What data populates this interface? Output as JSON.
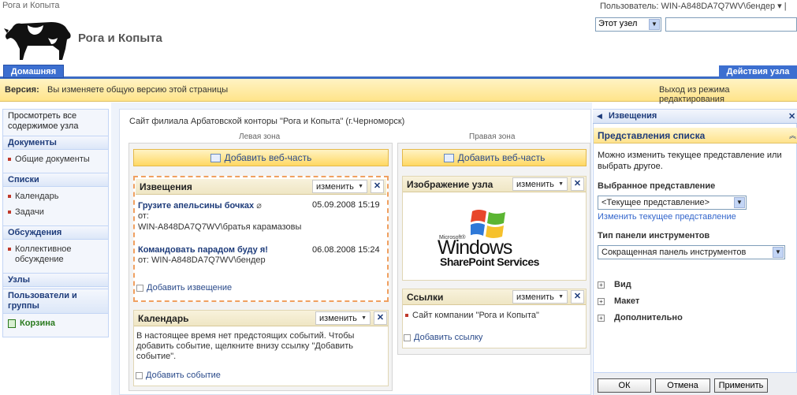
{
  "topbar": {
    "site_crumb": "Рога и Копыта",
    "user_label": "Пользователь: WIN-A848DA7Q7WV\\бендер ▾  |"
  },
  "header": {
    "site_title": "Рога и Копыта",
    "scope_value": "Этот узел",
    "search_value": ""
  },
  "nav": {
    "home_tab": "Домашняя",
    "site_actions": "Действия узла"
  },
  "edit_banner": {
    "version_label": "Версия:",
    "version_text": "Вы изменяете общую версию этой страницы",
    "exit_link": "Выход из режима редактирования"
  },
  "leftnav": {
    "view_all": "Просмотреть все содержимое узла",
    "documents": "Документы",
    "shared_docs": "Общие документы",
    "lists": "Списки",
    "calendar": "Календарь",
    "tasks": "Задачи",
    "discussions": "Обсуждения",
    "team_discussion": "Коллективное обсуждение",
    "sites": "Узлы",
    "people": "Пользователи и группы",
    "recycle_bin": "Корзина"
  },
  "page": {
    "description": "Сайт филиала Арбатовской конторы \"Рога и Копыта\" (г.Черноморск)",
    "left_zone": "Левая зона",
    "right_zone": "Правая зона",
    "add_web_part": "Добавить веб-часть"
  },
  "webparts": {
    "edit_label": "изменить",
    "close_label": "✕",
    "announcements": {
      "title": "Извещения",
      "items": [
        {
          "title": "Грузите апельсины бочках",
          "date": "05.09.2008 15:19",
          "from": "от:",
          "author": "WIN-A848DA7Q7WV\\братья карамазовы"
        },
        {
          "title": "Командовать парадом буду я!",
          "date": "06.08.2008 15:24",
          "from": "от:",
          "author": "WIN-A848DA7Q7WV\\бендер"
        }
      ],
      "add_link": "Добавить извещение"
    },
    "calendar": {
      "title": "Календарь",
      "text": "В настоящее время нет предстоящих событий. Чтобы добавить событие, щелкните внизу ссылку \"Добавить событие\".",
      "add_link": "Добавить событие"
    },
    "site_image": {
      "title": "Изображение узла",
      "logo_small": "Microsoft®",
      "logo_big": "Windows",
      "logo_sub": "SharePoint Services"
    },
    "links": {
      "title": "Ссылки",
      "items": [
        "Сайт компании \"Рога и Копыта\""
      ],
      "add_link": "Добавить ссылку"
    }
  },
  "toolpane": {
    "title": "Извещения",
    "section_title": "Представления списка",
    "intro": "Можно изменить текущее представление или выбрать другое.",
    "selected_view_label": "Выбранное представление",
    "selected_view_value": "<Текущее представление>",
    "edit_view_link": "Изменить текущее представление",
    "toolbar_type_label": "Тип панели инструментов",
    "toolbar_type_value": "Сокращенная панель инструментов",
    "expanders": [
      "Вид",
      "Макет",
      "Дополнительно"
    ],
    "ok": "ОК",
    "cancel": "Отмена",
    "apply": "Применить"
  },
  "colors": {
    "accent_blue": "#3c6fd0",
    "banner_yellow": "#ffe48a",
    "link_blue": "#3366cc"
  }
}
